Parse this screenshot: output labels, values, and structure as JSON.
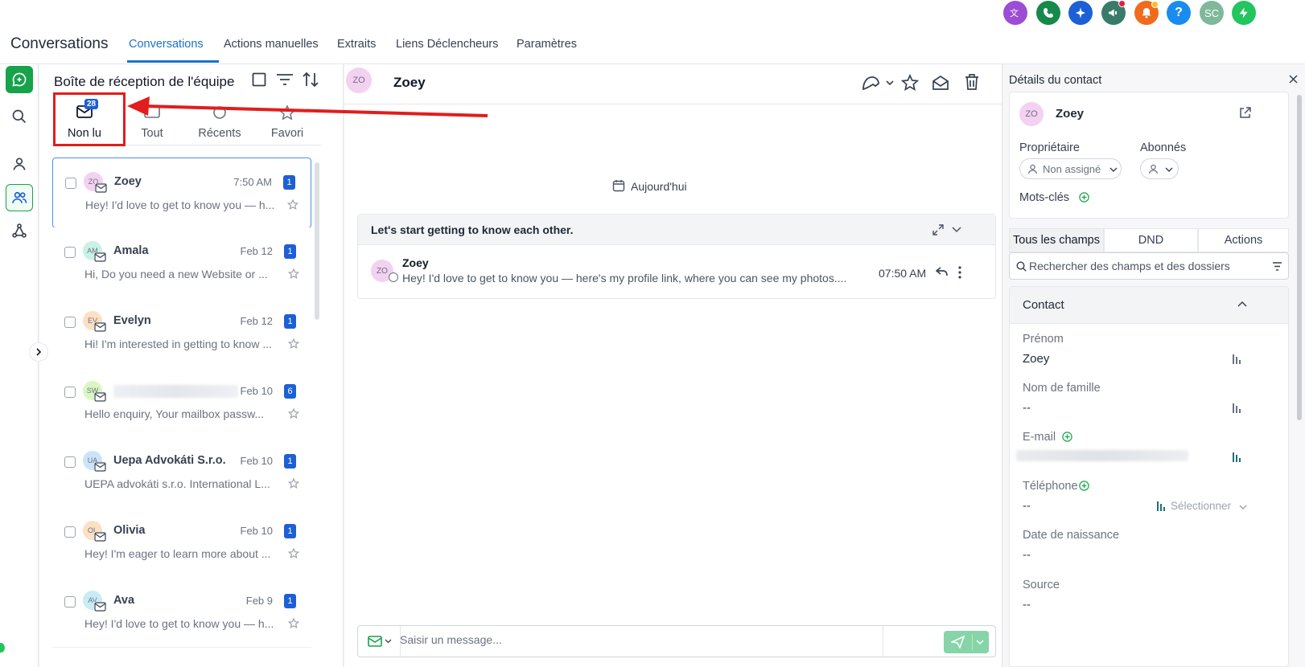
{
  "app": {
    "title": "Conversations"
  },
  "nav": {
    "tabs": [
      "Conversations",
      "Actions manuelles",
      "Extraits",
      "Liens Déclencheurs",
      "Paramètres"
    ]
  },
  "header": {
    "avatar_initials": "SC"
  },
  "inbox": {
    "title": "Boîte de réception de l'équipe",
    "filter_tabs": [
      {
        "label": "Non lu",
        "count": "28"
      },
      {
        "label": "Tout"
      },
      {
        "label": "Récents"
      },
      {
        "label": "Favori"
      }
    ],
    "conversations": [
      {
        "initials": "ZO",
        "name": "Zoey",
        "time": "7:50 AM",
        "unread": "1",
        "preview": "Hey! I'd love to get to know you — h...",
        "avatar_color": "#f3d1f1"
      },
      {
        "initials": "AM",
        "name": "Amala",
        "time": "Feb 12",
        "unread": "1",
        "preview": "Hi,   Do you need a new Website or ...",
        "avatar_color": "#c9f2e5"
      },
      {
        "initials": "EV",
        "name": "Evelyn",
        "time": "Feb 12",
        "unread": "1",
        "preview": "Hi! I'm interested in getting to know ...",
        "avatar_color": "#fde0c3"
      },
      {
        "initials": "SW",
        "name": "",
        "time": "Feb 10",
        "unread": "6",
        "preview": "Hello  enquiry, Your mailbox passw...",
        "avatar_color": "#d9f7c4"
      },
      {
        "initials": "UA",
        "name": "Uepa Advokáti S.r.o.",
        "time": "Feb 10",
        "unread": "1",
        "preview": "UEPA advokáti s.r.o. International L...",
        "avatar_color": "#cbe4fa"
      },
      {
        "initials": "OL",
        "name": "Olivia",
        "time": "Feb 10",
        "unread": "1",
        "preview": "Hey! I'm eager to learn more about ...",
        "avatar_color": "#fde0c3"
      },
      {
        "initials": "AV",
        "name": "Ava",
        "time": "Feb 9",
        "unread": "1",
        "preview": "Hey! I'd love to get to know you — h...",
        "avatar_color": "#c9ecf5"
      }
    ]
  },
  "chat": {
    "initials": "ZO",
    "name": "Zoey",
    "date_chip": "Aujourd'hui",
    "thread_title": "Let's start getting to know each other.",
    "message": {
      "initials": "ZO",
      "sender": "Zoey",
      "text": "Hey! I'd love to get to know you — here's my profile link, where you can see my photos....",
      "time": "07:50 AM"
    },
    "composer_placeholder": "Saisir un message..."
  },
  "contact": {
    "title": "Détails du contact",
    "initials": "ZO",
    "name": "Zoey",
    "owner_label": "Propriétaire",
    "owner_value": "Non assigné",
    "followers_label": "Abonnés",
    "tags_label": "Mots-clés",
    "tabs": [
      "Tous les champs",
      "DND",
      "Actions"
    ],
    "search_placeholder": "Rechercher des champs et des dossiers",
    "section_title": "Contact",
    "fields": [
      {
        "label": "Prénom",
        "value": "Zoey"
      },
      {
        "label": "Nom de famille",
        "value": "--"
      },
      {
        "label": "E-mail",
        "value": ""
      },
      {
        "label": "Téléphone",
        "value": "--",
        "select": "Sélectionner"
      },
      {
        "label": "Date de naissance",
        "value": "--"
      },
      {
        "label": "Source",
        "value": "--"
      }
    ]
  },
  "colors": {
    "accent": "#1a73c8",
    "badge": "#1d5fd6",
    "annotation": "#e11d1d",
    "green": "#16a34a"
  }
}
